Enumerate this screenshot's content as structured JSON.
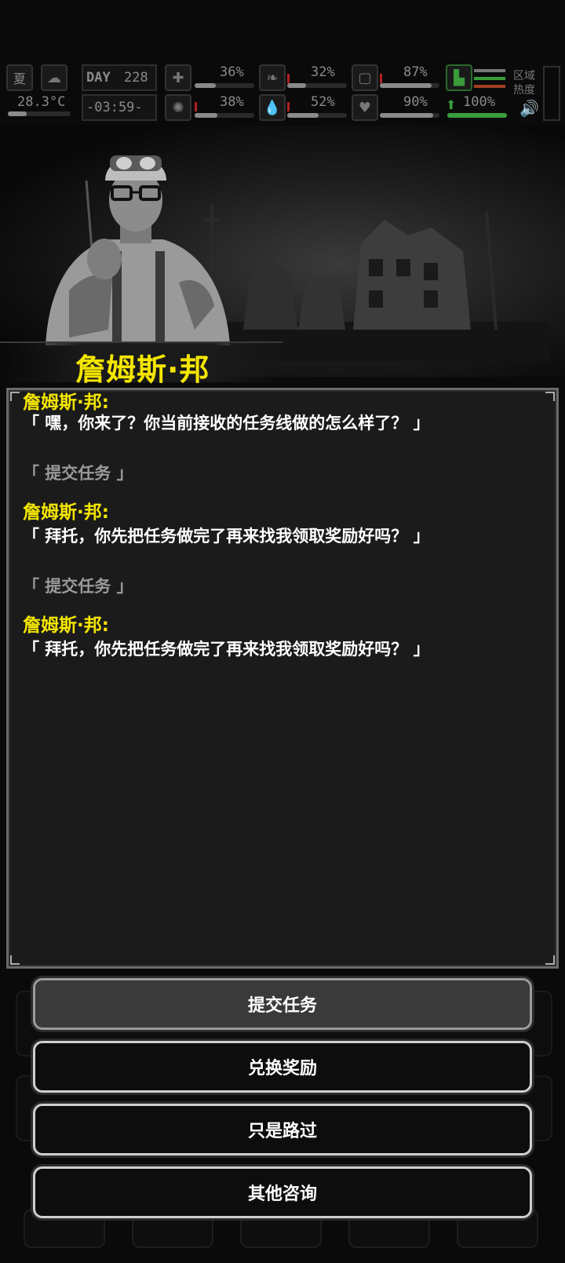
{
  "hud": {
    "season": "夏",
    "day_label": "DAY",
    "day_number": "228",
    "temperature": "28.3°C",
    "clock": "-03:59-",
    "stats_row1": [
      {
        "icon": "medkit-icon",
        "value": "36%",
        "level": 0.36
      },
      {
        "icon": "stomach-icon",
        "value": "32%",
        "level": 0.32
      },
      {
        "icon": "capsule-icon",
        "value": "87%",
        "level": 0.87
      },
      {
        "icon": "boot-icon",
        "value": "",
        "level": 0
      }
    ],
    "stats_row2": [
      {
        "icon": "brain-icon",
        "value": "38%",
        "level": 0.38
      },
      {
        "icon": "water-drop-icon",
        "value": "52%",
        "level": 0.52
      },
      {
        "icon": "heart-icon",
        "value": "90%",
        "level": 0.9
      },
      {
        "icon": "stamina-icon",
        "value": "100%",
        "level": 1.0
      }
    ],
    "zone_heat_label": "区域\n热度",
    "colors": {
      "accent_yellow": "#f4e600",
      "stamina_green": "#3a9d3a",
      "warn_red": "#b02020"
    }
  },
  "npc": {
    "name": "詹姆斯·邦"
  },
  "dialog": {
    "entries": [
      {
        "type": "npc",
        "speaker": "詹姆斯·邦:",
        "text": "「 嘿，你来了？你当前接收的任务线做的怎么样了？ 」"
      },
      {
        "type": "player",
        "text": "「 提交任务 」"
      },
      {
        "type": "npc",
        "speaker": "詹姆斯·邦:",
        "text": "「 拜托，你先把任务做完了再来找我领取奖励好吗？ 」"
      },
      {
        "type": "player",
        "text": "「 提交任务 」"
      },
      {
        "type": "npc",
        "speaker": "詹姆斯·邦:",
        "text": "「 拜托，你先把任务做完了再来找我领取奖励好吗？ 」"
      }
    ]
  },
  "options": [
    {
      "label": "提交任务",
      "selected": true
    },
    {
      "label": "兑换奖励",
      "selected": false
    },
    {
      "label": "只是路过",
      "selected": false
    },
    {
      "label": "其他咨询",
      "selected": false
    }
  ]
}
